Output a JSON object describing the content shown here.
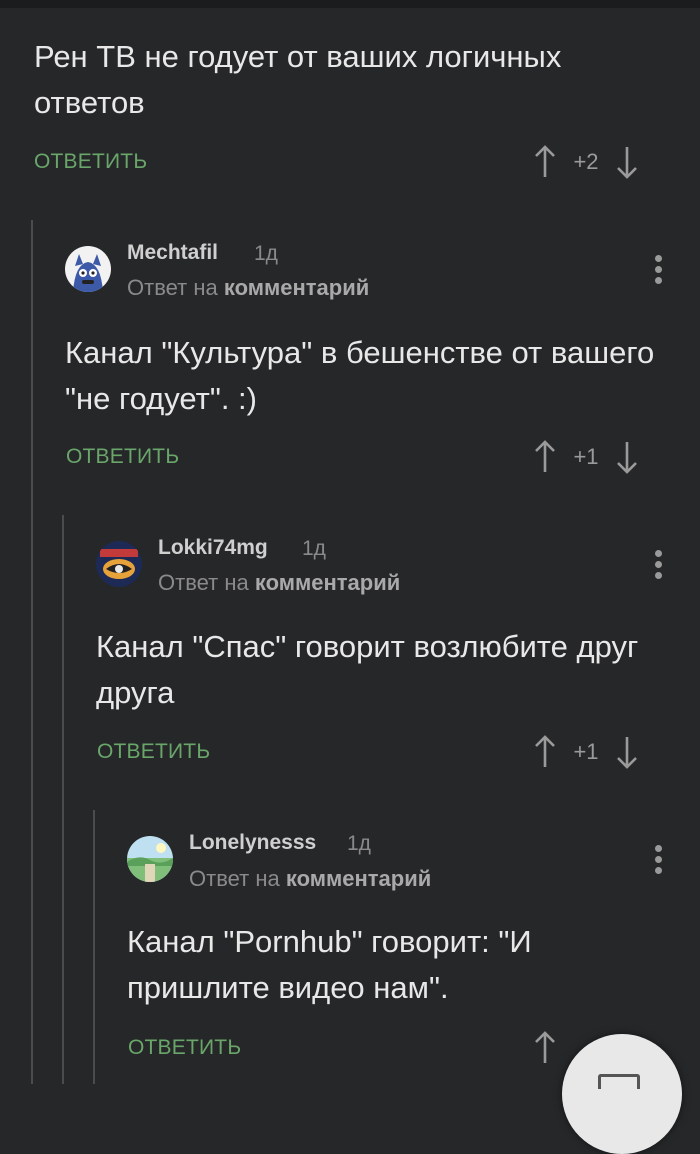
{
  "comments": [
    {
      "text": "Рен ТВ не годует от ваших логичных ответов",
      "reply_label": "ОТВЕТИТЬ",
      "score": "+2"
    },
    {
      "username": "Mechtafil",
      "time": "1д",
      "reply_to_prefix": "Ответ на",
      "reply_to_link": "комментарий",
      "text": "Канал \"Культура\" в бешенстве от вашего \"не годует\". :)",
      "reply_label": "ОТВЕТИТЬ",
      "score": "+1"
    },
    {
      "username": "Lokki74mg",
      "time": "1д",
      "reply_to_prefix": "Ответ на",
      "reply_to_link": "комментарий",
      "text": "Канал \"Спас\" говорит возлюбите друг друга",
      "reply_label": "ОТВЕТИТЬ",
      "score": "+1"
    },
    {
      "username": "Lonelynesss",
      "time": "1д",
      "reply_to_prefix": "Ответ на",
      "reply_to_link": "комментарий",
      "text": "Канал \"Pornhub\" говорит: \"И пришлите видео нам\".",
      "reply_label": "ОТВЕТИТЬ"
    }
  ],
  "icons": {
    "upvote": "arrow-up-icon",
    "downvote": "arrow-down-icon",
    "more": "more-vertical-icon",
    "fab": "comment-icon"
  },
  "colors": {
    "background": "#252729",
    "reply_accent": "#6aa56a"
  }
}
